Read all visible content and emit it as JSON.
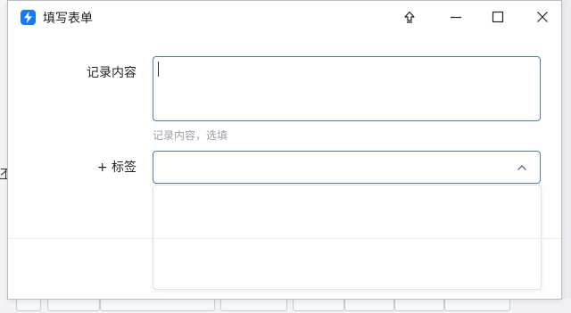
{
  "background": {
    "left_text": "不"
  },
  "window": {
    "title": "填写表单",
    "icon": "lightning-icon",
    "controls": [
      "pin-icon",
      "minimize-icon",
      "maximize-icon",
      "close-icon"
    ]
  },
  "form": {
    "record": {
      "label": "记录内容",
      "value": "",
      "hint": "记录内容，选填"
    },
    "tags": {
      "label": "+ 标签",
      "value": ""
    }
  },
  "colors": {
    "accent": "#1677ff",
    "focus_border": "#4c73d6",
    "hint_text": "#9aa0a8"
  }
}
